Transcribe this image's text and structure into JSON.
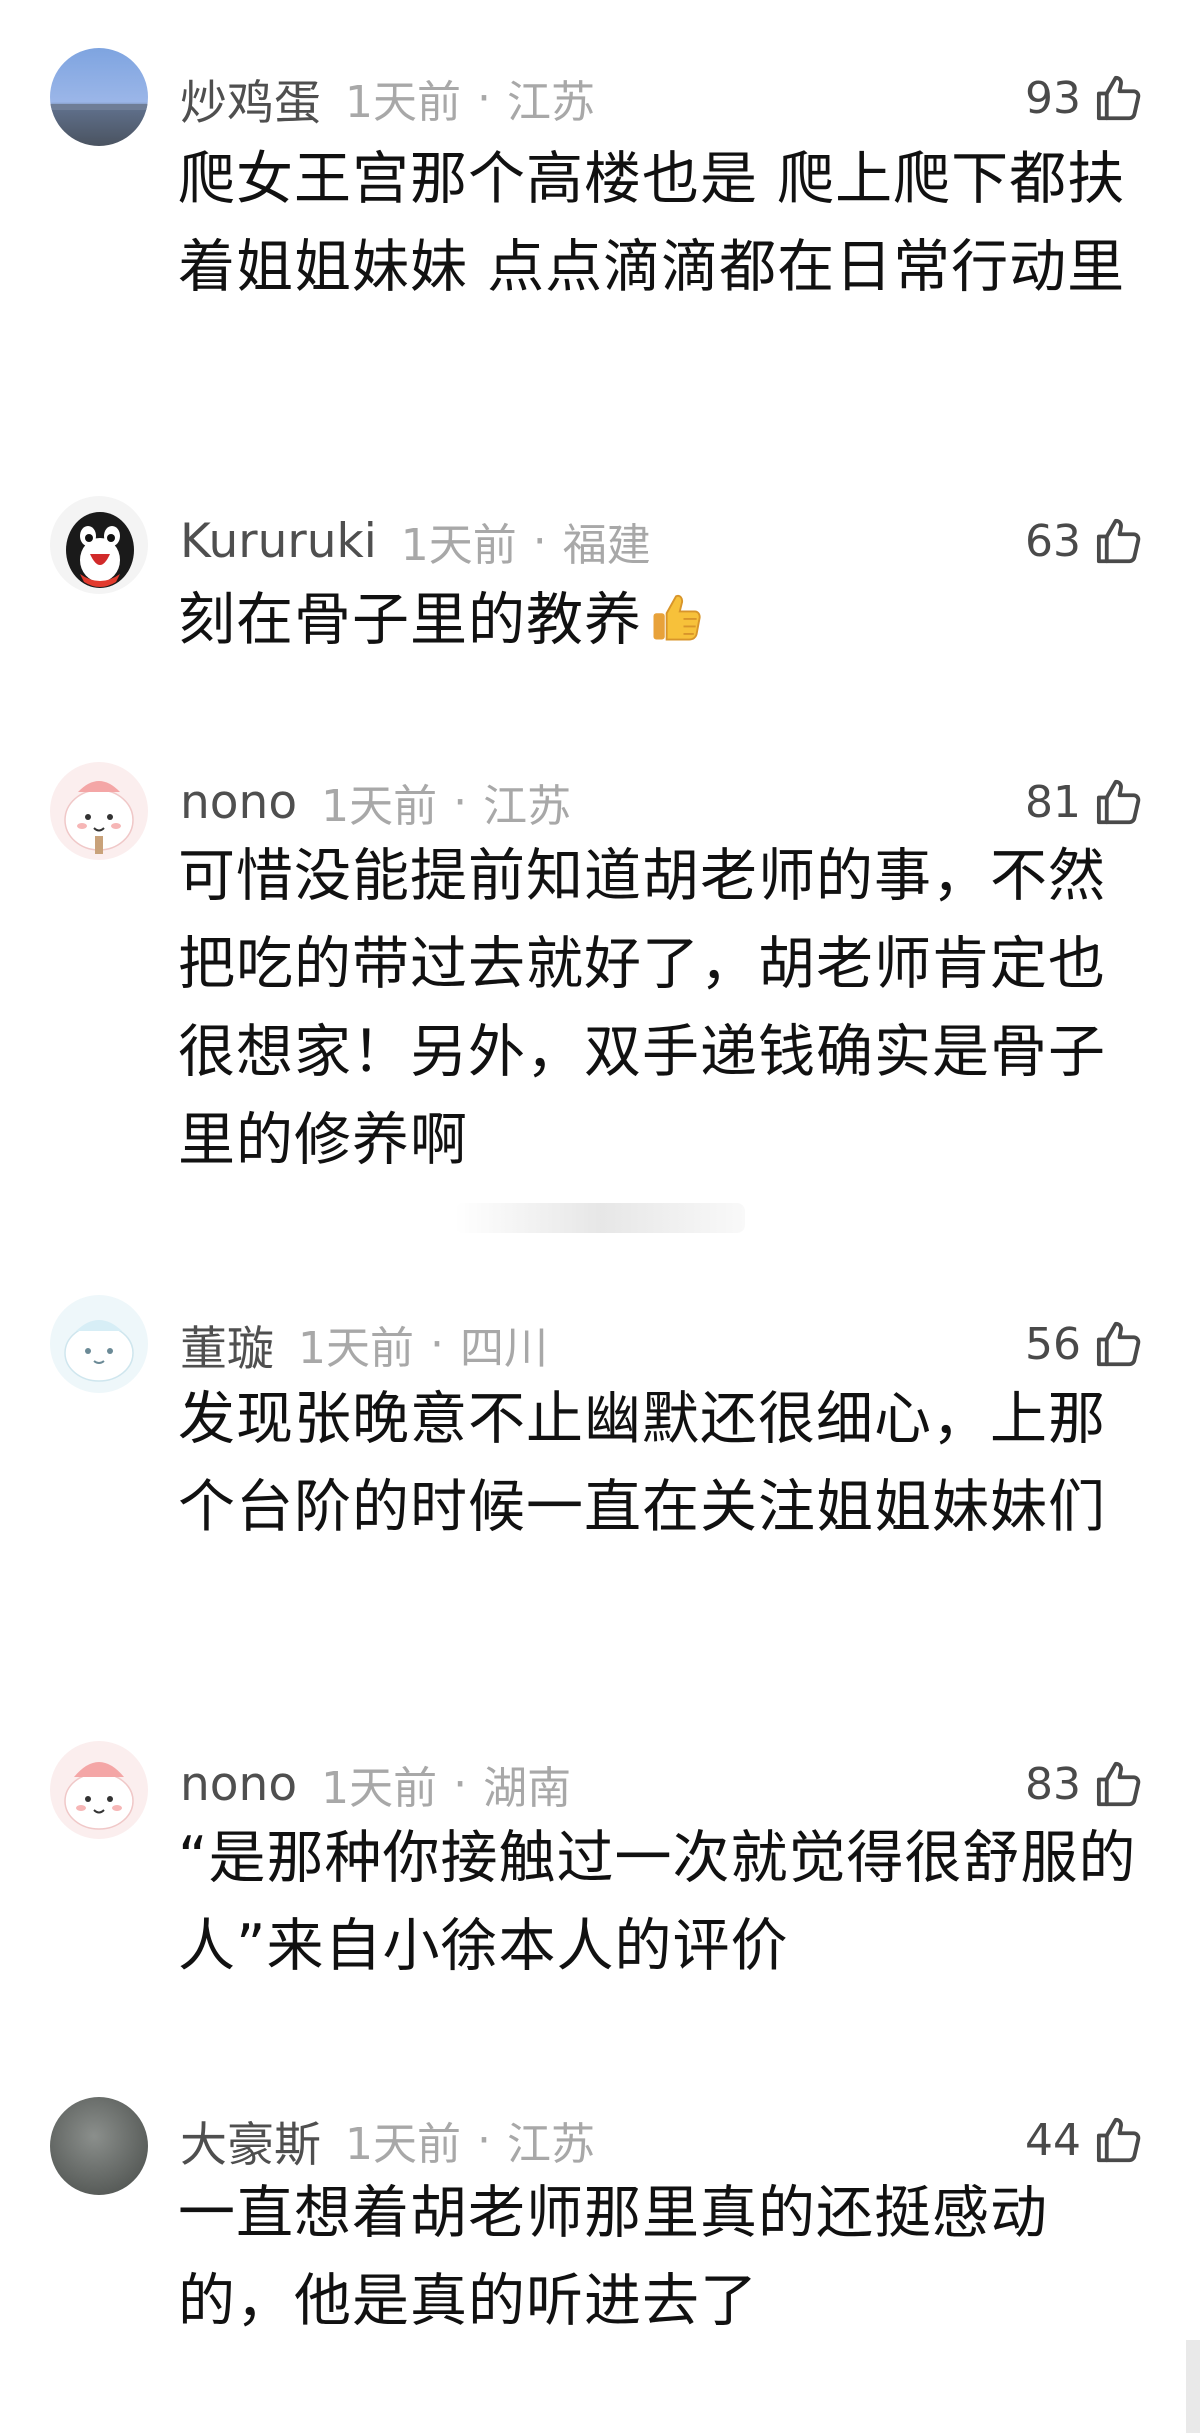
{
  "comments": [
    {
      "username": "炒鸡蛋",
      "time": "1天前",
      "location": "江苏",
      "likes": "93",
      "avatar": "landscape-avatar",
      "text": "爬女王宫那个高楼也是  爬上爬下都扶着姐姐妹妹  点点滴滴都在日常行动里"
    },
    {
      "username": "Kururuki",
      "time": "1天前",
      "location": "福建",
      "likes": "63",
      "avatar": "penguin-avatar",
      "text": "刻在骨子里的教养"
    },
    {
      "username": "nono",
      "time": "1天前",
      "location": "江苏",
      "likes": "81",
      "avatar": "pink-cartoon-avatar",
      "text": "可惜没能提前知道胡老师的事，不然把吃的带过去就好了，胡老师肯定也很想家！另外，双手递钱确实是骨子里的修养啊"
    },
    {
      "username": "董璇",
      "time": "1天前",
      "location": "四川",
      "likes": "56",
      "avatar": "blue-cartoon-avatar",
      "text": "发现张晚意不止幽默还很细心，上那个台阶的时候一直在关注姐姐妹妹们"
    },
    {
      "username": "nono",
      "time": "1天前",
      "location": "湖南",
      "likes": "83",
      "avatar": "pink-cartoon-avatar",
      "text": "“是那种你接触过一次就觉得很舒服的人”来自小徐本人的评价"
    },
    {
      "username": "大豪斯",
      "time": "1天前",
      "location": "江苏",
      "likes": "44",
      "avatar": "gray-avatar",
      "text": "一直想着胡老师那里真的还挺感动的，他是真的听进去了"
    }
  ],
  "separator": "·",
  "icons": {
    "like": "thumbs-up-outline-icon",
    "emoji": "thumbs-up-emoji"
  },
  "colors": {
    "username": "#4f4f4f",
    "meta": "#a8a8a8",
    "text": "#111111",
    "likes": "#4a4a4a"
  }
}
